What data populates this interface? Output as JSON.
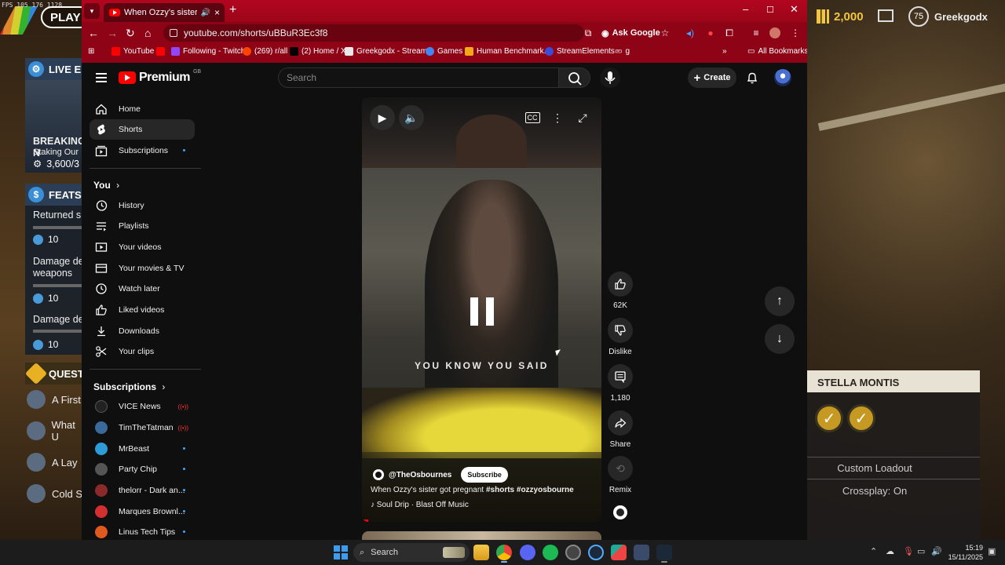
{
  "game": {
    "fps": "FPS 105 176 1128",
    "play_label": "PLAY",
    "live_label": "LIVE E",
    "breaking_title": "BREAKING N",
    "breaking_sub": "Staking Our",
    "breaking_count": "3,600/3",
    "feats_label": "FEATS",
    "feats": [
      {
        "text": "Returned s",
        "value": "10"
      },
      {
        "text": "Damage de weapons",
        "value": "10"
      },
      {
        "text": "Damage de",
        "value": "10"
      }
    ],
    "quest_label": "QUEST",
    "quests": [
      "A First",
      "What U",
      "A Lay",
      "Cold S"
    ],
    "currency": "2,000",
    "level": "75",
    "player_name": "Greekgodx",
    "stella_title": "STELLA MONTIS",
    "custom_loadout": "Custom Loadout",
    "crossplay": "Crossplay: On"
  },
  "browser": {
    "tab_title": "When Ozzy's sister got preg",
    "url": "youtube.com/shorts/uBBuR3Ec3f8",
    "ask_google": "Ask Google",
    "bookmarks": [
      "YouTube",
      "Following - Twitch",
      "(269) r/all",
      "(2) Home / X",
      "Greekgodx - Stream...",
      "Games",
      "Human Benchmark...",
      "StreamElements -",
      "g"
    ],
    "all_bookmarks": "All Bookmarks",
    "bookmark_colors": [
      "#ff0000",
      "#9146ff",
      "#ff4500",
      "#000000",
      "#e8e8e8",
      "#4285f4",
      "#f3a71a",
      "#3a4cd8",
      "#cccccc"
    ]
  },
  "youtube": {
    "brand": "Premium",
    "region": "GB",
    "search_placeholder": "Search",
    "create_label": "Create",
    "nav": [
      {
        "label": "Home",
        "icon": "home-icon"
      },
      {
        "label": "Shorts",
        "icon": "shorts-icon",
        "active": true
      },
      {
        "label": "Subscriptions",
        "icon": "subscriptions-icon"
      }
    ],
    "you_label": "You",
    "you_items": [
      {
        "label": "History",
        "icon": "history-icon"
      },
      {
        "label": "Playlists",
        "icon": "playlists-icon"
      },
      {
        "label": "Your videos",
        "icon": "your-videos-icon"
      },
      {
        "label": "Your movies & TV",
        "icon": "movies-icon"
      },
      {
        "label": "Watch later",
        "icon": "watch-later-icon"
      },
      {
        "label": "Liked videos",
        "icon": "liked-icon"
      },
      {
        "label": "Downloads",
        "icon": "download-icon"
      },
      {
        "label": "Your clips",
        "icon": "clips-icon"
      }
    ],
    "subscriptions_label": "Subscriptions",
    "subscriptions": [
      {
        "name": "VICE News",
        "live": true,
        "color": "#222222"
      },
      {
        "name": "TimTheTatman",
        "live": true,
        "color": "#3a6a9a"
      },
      {
        "name": "MrBeast",
        "live": false,
        "color": "#2e9ad8"
      },
      {
        "name": "Party Chip",
        "live": false,
        "color": "#555555"
      },
      {
        "name": "thelorr - Dark an...",
        "live": false,
        "color": "#8a2a2a"
      },
      {
        "name": "Marques Brownl...",
        "live": false,
        "color": "#d23030"
      },
      {
        "name": "Linus Tech Tips",
        "live": false,
        "color": "#e05a20"
      }
    ],
    "video": {
      "caption": "YOU KNOW YOU SAID",
      "channel": "@TheOsbournes",
      "subscribe": "Subscribe",
      "title_text": "When Ozzy's sister got pregnant ",
      "title_tags": "#shorts #ozzyosbourne",
      "music": "Soul Drip · Blast Off Music"
    },
    "actions": {
      "likes": "62K",
      "dislike": "Dislike",
      "comments": "1,180",
      "share": "Share",
      "remix": "Remix"
    }
  },
  "taskbar": {
    "search": "Search",
    "time": "15:19",
    "date": "15/11/2025"
  }
}
